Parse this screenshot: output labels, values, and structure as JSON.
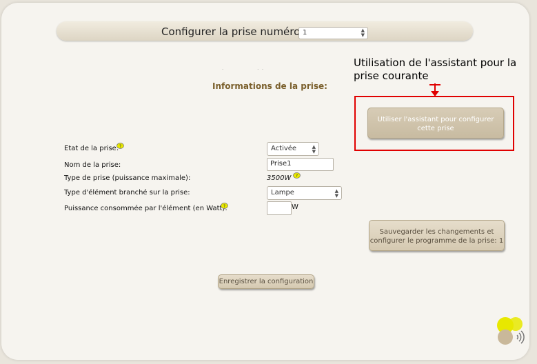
{
  "header": {
    "label": "Configurer la prise numéro",
    "outlet_number": "1"
  },
  "annotation": {
    "text": "Utilisation de l'assistant  pour la prise courante"
  },
  "section": {
    "title": "Informations de la prise:"
  },
  "assistant_button": {
    "label": "Utiliser l'assistant pour configurer cette prise"
  },
  "form": {
    "state_label": "Etat de la prise:",
    "state_value": "Activée",
    "name_label": "Nom de la prise:",
    "name_value": "Prise1",
    "type_label": "Type de prise (puissance maximale):",
    "type_value": "3500W",
    "element_label": "Type d'élément branché sur la prise:",
    "element_value": "Lampe",
    "power_label": "Puissance consommée par l'élément (en Watt):",
    "power_value": "",
    "power_unit": "W"
  },
  "save_program_button": {
    "label": "Sauvegarder les changements et configurer le programme de la prise: 1"
  },
  "save_config_button": {
    "label": "Enregistrer la configuration"
  },
  "colors": {
    "annotation_box": "#e00000",
    "section_title": "#7a5f2c",
    "button": "#c8bba1"
  }
}
